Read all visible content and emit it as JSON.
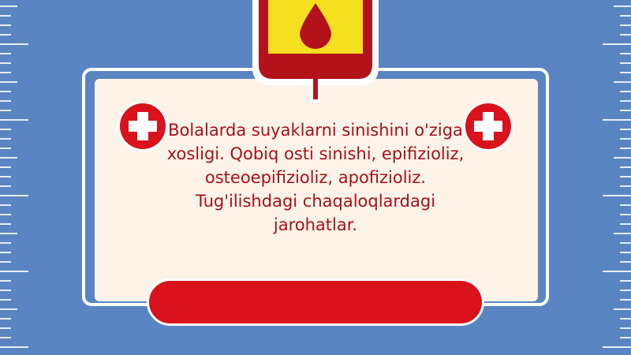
{
  "slide": {
    "body_text": "Bolalarda suyaklarni sinishini o'ziga xosligi. Qobiq osti sinishi, epifizioliz, osteoepifizioliz, apofizioliz. Tug'ilishdagi chaqaloqlardagi jarohatlar."
  },
  "icons": {
    "blood_bag": "blood-bag-icon",
    "badge_left": "red-cross-icon",
    "badge_right": "red-cross-icon"
  },
  "colors": {
    "background": "#5a85c2",
    "card": "#fdf3e9",
    "accent_red": "#d9121c",
    "text_red": "#a8101a",
    "bag_yellow": "#f4e01f"
  }
}
